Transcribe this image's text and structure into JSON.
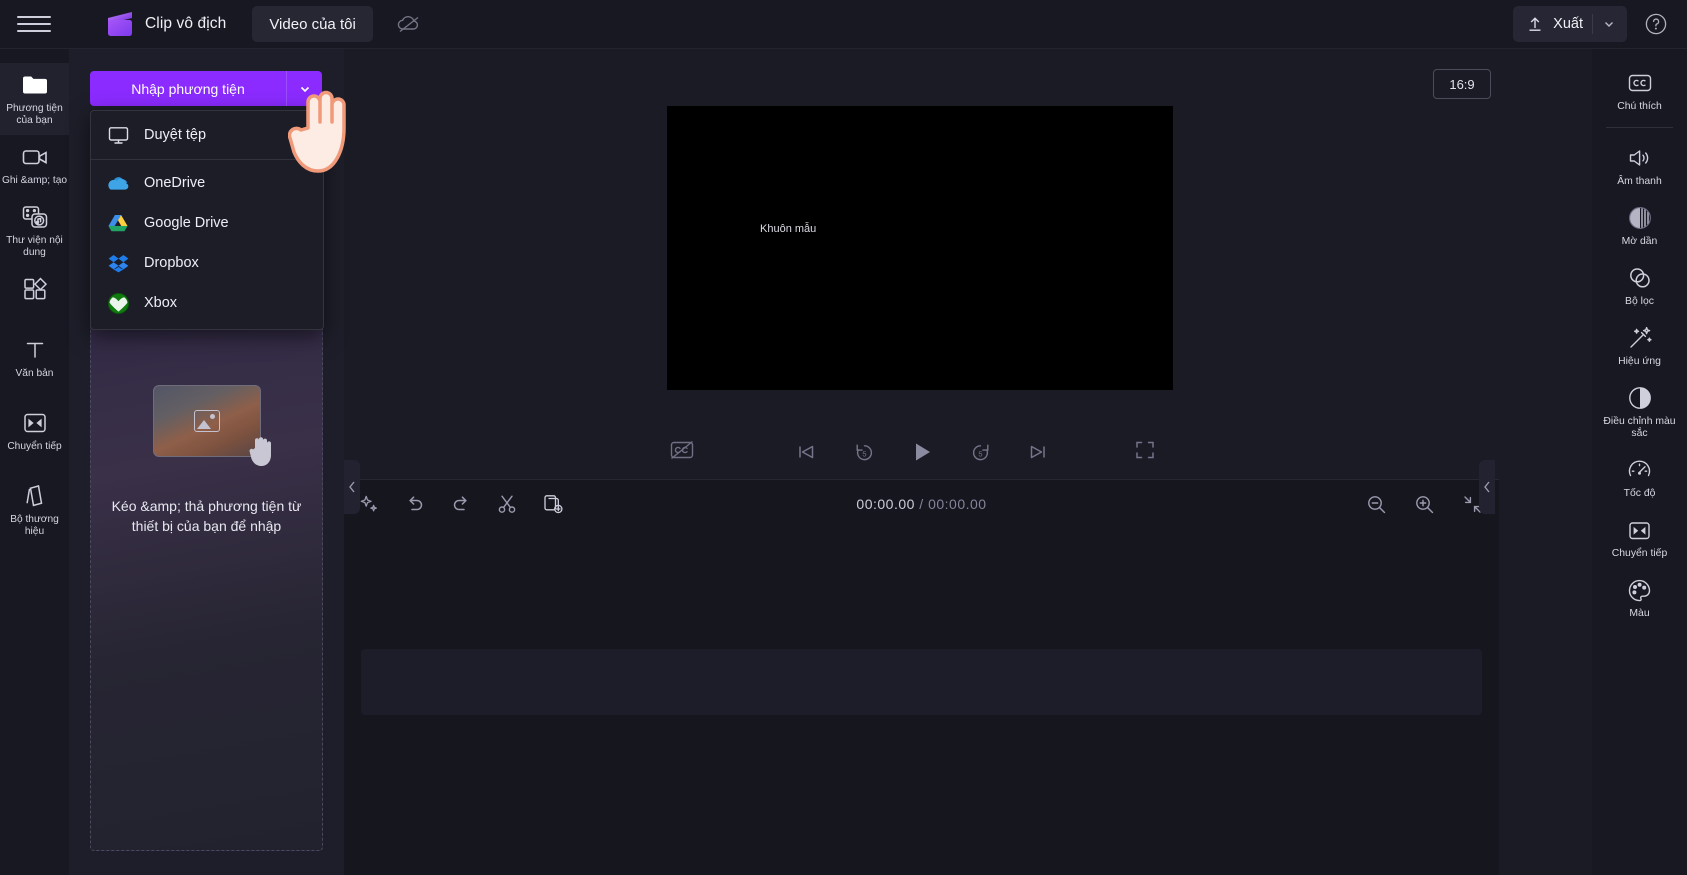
{
  "topbar": {
    "menu_icon": "hamburger-icon",
    "brand_logo": "clipchamp-logo",
    "brand_title": "Clip vô địch",
    "tab_my_video": "Video của tôi",
    "cloud_icon": "cloud-off-icon",
    "export_label": "Xuất",
    "export_icon": "upload-icon",
    "export_caret_icon": "chevron-down-icon",
    "help_icon": "help-circle-icon"
  },
  "left_rail": {
    "items": [
      {
        "label": "Phương tiện của bạn",
        "icon": "folder-icon",
        "active": true
      },
      {
        "label": "Ghi &amp; tạo",
        "icon": "video-camera-icon",
        "active": false
      },
      {
        "label": "Thư viện nội dung",
        "icon": "content-library-icon",
        "active": false
      },
      {
        "label": "",
        "icon": "templates-grid-icon",
        "active": false
      },
      {
        "label": "Văn bản",
        "icon": "text-T-icon",
        "active": false
      },
      {
        "label": "Chuyển tiếp",
        "icon": "transition-icon",
        "active": false
      },
      {
        "label": "Bộ thương hiệu",
        "icon": "brand-kit-icon",
        "active": false
      }
    ]
  },
  "left_panel": {
    "import_button_label": "Nhập phương tiện",
    "import_caret_icon": "chevron-down-icon",
    "dropzone_text": "Kéo &amp; thả phương tiện từ thiết bị của bạn để nhập",
    "dropzone_thumb_icon": "image-placeholder-icon",
    "dropzone_hand_icon": "hand-drag-icon"
  },
  "import_menu": {
    "visible": true,
    "items": [
      {
        "label": "Duyệt tệp",
        "icon": "monitor-icon",
        "separator_after": true
      },
      {
        "label": "OneDrive",
        "icon": "onedrive-icon",
        "separator_after": false
      },
      {
        "label": "Google Drive",
        "icon": "google-drive-icon",
        "separator_after": false
      },
      {
        "label": "Dropbox",
        "icon": "dropbox-icon",
        "separator_after": false
      },
      {
        "label": "Xbox",
        "icon": "xbox-icon",
        "separator_after": false
      }
    ]
  },
  "preview": {
    "aspect_ratio": "16:9",
    "stage_label": "Khuôn mẫu",
    "controls": [
      {
        "name": "captions-off-button",
        "icon": "cc-off-icon"
      },
      {
        "name": "skip-to-start-button",
        "icon": "skip-previous-icon"
      },
      {
        "name": "rewind-5-button",
        "icon": "replay-5-icon"
      },
      {
        "name": "play-button",
        "icon": "play-icon"
      },
      {
        "name": "forward-5-button",
        "icon": "forward-5-icon"
      },
      {
        "name": "skip-to-end-button",
        "icon": "skip-next-icon"
      },
      {
        "name": "fullscreen-button",
        "icon": "fullscreen-icon"
      }
    ]
  },
  "timeline": {
    "tools": [
      {
        "name": "auto-compose-button",
        "icon": "sparkle-icon"
      },
      {
        "name": "undo-button",
        "icon": "undo-arrow-icon"
      },
      {
        "name": "redo-button",
        "icon": "redo-arrow-icon"
      },
      {
        "name": "split-button",
        "icon": "scissors-icon"
      },
      {
        "name": "duplicate-button",
        "icon": "duplicate-add-icon"
      }
    ],
    "current_time": "00:00.00",
    "separator": " / ",
    "total_time": "00:00.00",
    "zoom_out_icon": "zoom-out-icon",
    "zoom_in_icon": "zoom-in-icon",
    "fit_icon": "fit-to-screen-icon"
  },
  "collapse": {
    "left_icon": "chevron-left-icon",
    "right_icon": "chevron-left-icon"
  },
  "right_rail": {
    "items": [
      {
        "label": "Chú thích",
        "icon": "cc-icon",
        "separator_after": true
      },
      {
        "label": "Âm thanh",
        "icon": "speaker-icon",
        "separator_after": false
      },
      {
        "label": "Mờ dần",
        "icon": "fade-icon",
        "separator_after": false
      },
      {
        "label": "Bộ lọc",
        "icon": "filters-icon",
        "separator_after": false
      },
      {
        "label": "Hiệu ứng",
        "icon": "magic-wand-icon",
        "separator_after": false
      },
      {
        "label": "Điều chỉnh màu sắc",
        "icon": "contrast-icon",
        "separator_after": false
      },
      {
        "label": "Tốc độ",
        "icon": "speedometer-icon",
        "separator_after": false
      },
      {
        "label": "Chuyển tiếp",
        "icon": "transition-icon",
        "separator_after": false
      },
      {
        "label": "Màu",
        "icon": "palette-icon",
        "separator_after": false
      }
    ]
  },
  "colors": {
    "accent": "#8b2bff",
    "bg": "#1b1b26",
    "panel": "#181823",
    "timeline_bg": "#16161f"
  }
}
